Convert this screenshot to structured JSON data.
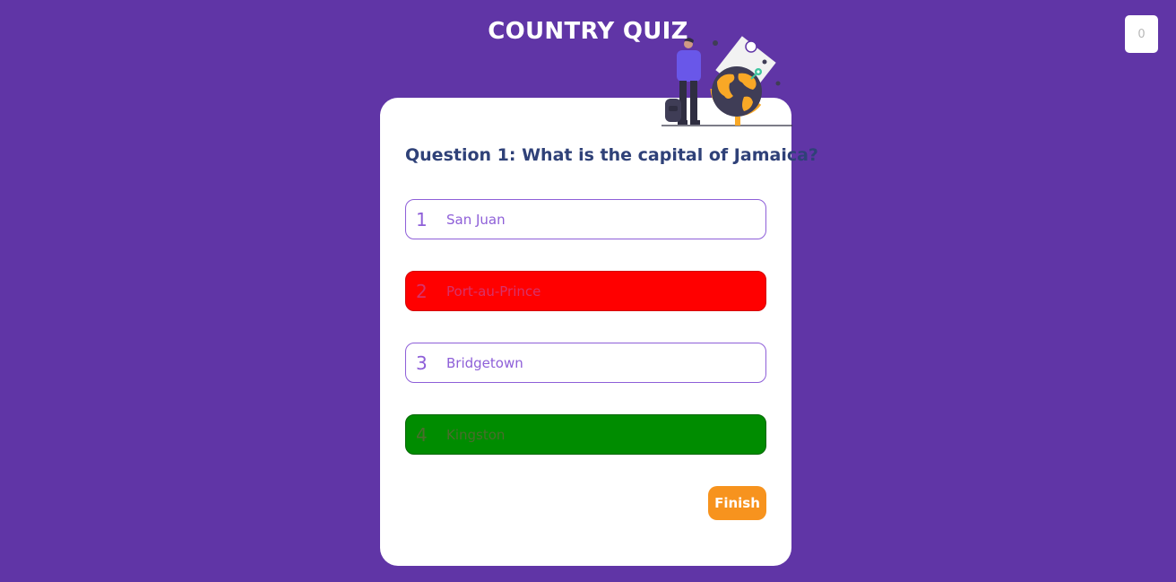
{
  "header": {
    "title": "COUNTRY QUIZ",
    "score": "0"
  },
  "illustration": {
    "icon": "traveler-with-globe-illustration"
  },
  "quiz": {
    "question": "Question 1: What is the capital of Jamaica?",
    "options": [
      {
        "number": "1",
        "text": "San Juan",
        "state": "neutral"
      },
      {
        "number": "2",
        "text": "Port-au-Prince",
        "state": "wrong"
      },
      {
        "number": "3",
        "text": "Bridgetown",
        "state": "neutral"
      },
      {
        "number": "4",
        "text": "Kingston",
        "state": "correct"
      }
    ],
    "finish_label": "Finish"
  },
  "colors": {
    "background": "#6035a6",
    "accent": "#8e5fd8",
    "question_text": "#2f4178",
    "wrong": "#ff0000",
    "correct": "#008c00",
    "finish": "#f7931e"
  }
}
